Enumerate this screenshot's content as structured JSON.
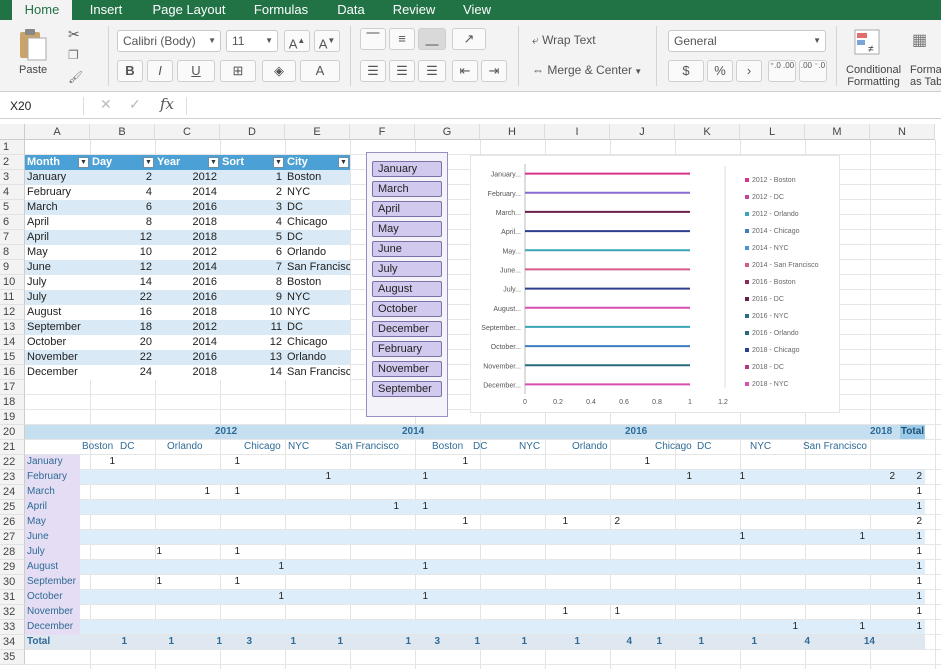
{
  "tabs": [
    "Home",
    "Insert",
    "Page Layout",
    "Formulas",
    "Data",
    "Review",
    "View"
  ],
  "ribbon": {
    "paste": "Paste",
    "font_name": "Calibri (Body)",
    "font_size": "11",
    "bold": "B",
    "italic": "I",
    "underline": "U",
    "wrap_text": "Wrap Text",
    "merge_center": "Merge & Center",
    "number_format": "General",
    "currency": "$",
    "percent": "%",
    "comma": "›",
    "dec_inc": "⁺.0 .00",
    "dec_dec": ".00 ⁻.0",
    "conditional": "Conditional",
    "formatting": "Formatting",
    "format_as": "Format",
    "as_table": "as Table"
  },
  "formula_bar": {
    "name_box": "X20",
    "fx": "fx",
    "formula": ""
  },
  "columns": [
    "A",
    "B",
    "C",
    "D",
    "E",
    "F",
    "G",
    "H",
    "I",
    "J",
    "K",
    "L",
    "M",
    "N"
  ],
  "rows": [
    "1",
    "2",
    "3",
    "4",
    "5",
    "6",
    "7",
    "8",
    "9",
    "10",
    "11",
    "12",
    "13",
    "14",
    "15",
    "16",
    "17",
    "18",
    "19",
    "20",
    "21",
    "22",
    "23",
    "24",
    "25",
    "26",
    "27",
    "28",
    "29",
    "30",
    "31",
    "32",
    "33",
    "34",
    "35"
  ],
  "table": {
    "headers": [
      "Month",
      "Day",
      "Year",
      "Sort",
      "City"
    ],
    "rows": [
      [
        "January",
        "2",
        "2012",
        "1",
        "Boston"
      ],
      [
        "February",
        "4",
        "2014",
        "2",
        "NYC"
      ],
      [
        "March",
        "6",
        "2016",
        "3",
        "DC"
      ],
      [
        "April",
        "8",
        "2018",
        "4",
        "Chicago"
      ],
      [
        "April",
        "12",
        "2018",
        "5",
        "DC"
      ],
      [
        "May",
        "10",
        "2012",
        "6",
        "Orlando"
      ],
      [
        "June",
        "12",
        "2014",
        "7",
        "San Francisco"
      ],
      [
        "July",
        "14",
        "2016",
        "8",
        "Boston"
      ],
      [
        "July",
        "22",
        "2016",
        "9",
        "NYC"
      ],
      [
        "August",
        "16",
        "2018",
        "10",
        "NYC"
      ],
      [
        "September",
        "18",
        "2012",
        "11",
        "DC"
      ],
      [
        "October",
        "20",
        "2014",
        "12",
        "Chicago"
      ],
      [
        "November",
        "22",
        "2016",
        "13",
        "Orlando"
      ],
      [
        "December",
        "24",
        "2018",
        "14",
        "San Francisco"
      ]
    ]
  },
  "slicer": {
    "items": [
      "January",
      "March",
      "April",
      "May",
      "June",
      "July",
      "August",
      "October",
      "December",
      "February",
      "November",
      "September"
    ]
  },
  "chart_data": {
    "type": "bar",
    "categories": [
      "January...",
      "February...",
      "March...",
      "April...",
      "May...",
      "June...",
      "July...",
      "August...",
      "September...",
      "October...",
      "November...",
      "December..."
    ],
    "xlim": [
      0,
      1.2
    ],
    "xticks": [
      "0",
      "0.2",
      "0.4",
      "0.6",
      "0.8",
      "1",
      "1.2"
    ],
    "series": [
      {
        "name": "2012 - Boston",
        "color": "#d6338a"
      },
      {
        "name": "2012 - DC",
        "color": "#c2479a"
      },
      {
        "name": "2012 - Orlando",
        "color": "#3aa6b5"
      },
      {
        "name": "2014 - Chicago",
        "color": "#3d7ebf"
      },
      {
        "name": "2014 - NYC",
        "color": "#4b8fd6"
      },
      {
        "name": "2014 - San Francisco",
        "color": "#d75a8c"
      },
      {
        "name": "2016 - Boston",
        "color": "#8a2b5c"
      },
      {
        "name": "2016 - DC",
        "color": "#6a1d4d"
      },
      {
        "name": "2016 - NYC",
        "color": "#2b6c8a"
      },
      {
        "name": "2016 - Orlando",
        "color": "#256b7a"
      },
      {
        "name": "2018 - Chicago",
        "color": "#2c3e8c"
      },
      {
        "name": "2018 - DC",
        "color": "#b83583"
      },
      {
        "name": "2018 - NYC",
        "color": "#d94fb1"
      }
    ],
    "bars": [
      {
        "category": "January...",
        "value": 1,
        "color": "#d6338a"
      },
      {
        "category": "February...",
        "value": 1,
        "color": "#8a6ad6"
      },
      {
        "category": "March...",
        "value": 1,
        "color": "#6a1d4d"
      },
      {
        "category": "April...",
        "value": 1,
        "color": "#2c3e8c"
      },
      {
        "category": "May...",
        "value": 1,
        "color": "#3aa6b5"
      },
      {
        "category": "June...",
        "value": 1,
        "color": "#d75a8c"
      },
      {
        "category": "July...",
        "value": 1,
        "color": "#2c3e8c"
      },
      {
        "category": "August...",
        "value": 1,
        "color": "#d94fb1"
      },
      {
        "category": "September...",
        "value": 1,
        "color": "#3aa6b5"
      },
      {
        "category": "October...",
        "value": 1,
        "color": "#3d7ebf"
      },
      {
        "category": "November...",
        "value": 1,
        "color": "#256b7a"
      },
      {
        "category": "December...",
        "value": 1,
        "color": "#d94fb1"
      }
    ]
  },
  "pivot": {
    "years": [
      "2012",
      "2014",
      "2016",
      "2018",
      "Total"
    ],
    "cities": [
      "Boston",
      "DC",
      "Orlando",
      "Chicago",
      "NYC",
      "San Francisco",
      "Boston",
      "DC",
      "NYC",
      "Orlando",
      "Chicago",
      "DC",
      "NYC",
      "San Francisco"
    ],
    "months": [
      "January",
      "February",
      "March",
      "April",
      "May",
      "June",
      "July",
      "August",
      "September",
      "October",
      "November",
      "December",
      "Total"
    ],
    "cells": [
      [
        "1",
        "",
        "",
        "1",
        "",
        "",
        "",
        "",
        "1",
        "",
        "",
        "",
        "",
        "",
        "",
        "1"
      ],
      [
        "",
        "",
        "",
        "",
        "",
        "1",
        "",
        "1",
        "",
        "",
        "",
        "1",
        "1",
        "",
        "2",
        "2"
      ],
      [
        "",
        "",
        "1",
        "1",
        "",
        "",
        "",
        "",
        "",
        "",
        "",
        "",
        "",
        "",
        "",
        "1"
      ],
      [
        "",
        "",
        "",
        "",
        "",
        "",
        "1",
        "1",
        "",
        "",
        "",
        "",
        "",
        "",
        "",
        "1"
      ],
      [
        "",
        "",
        "",
        "",
        "",
        "",
        "",
        "",
        "1",
        "",
        "1",
        "2",
        "",
        "",
        "",
        "2"
      ],
      [
        "",
        "",
        "",
        "",
        "",
        "",
        "",
        "",
        "",
        "",
        "",
        "",
        "",
        "1",
        "1",
        "1"
      ],
      [
        "",
        "1",
        "",
        "1",
        "",
        "",
        "",
        "",
        "",
        "",
        "",
        "",
        "",
        "",
        "",
        "1"
      ],
      [
        "",
        "",
        "",
        "",
        "1",
        "",
        "",
        "1",
        "",
        "",
        "",
        "",
        "",
        "",
        "",
        "1"
      ],
      [
        "",
        "1",
        "",
        "1",
        "",
        "",
        "",
        "",
        "",
        "",
        "",
        "",
        "",
        "",
        "",
        "1"
      ],
      [
        "",
        "",
        "",
        "",
        "1",
        "",
        "",
        "1",
        "",
        "",
        "",
        "",
        "",
        "",
        "",
        "1"
      ],
      [
        "",
        "",
        "",
        "",
        "",
        "",
        "",
        "",
        "",
        "",
        "1",
        "1",
        "",
        "",
        "",
        "1"
      ],
      [
        "",
        "",
        "",
        "",
        "",
        "",
        "",
        "",
        "",
        "",
        "",
        "",
        "",
        "1",
        "1",
        "1"
      ],
      [
        "1",
        "1",
        "1",
        "3",
        "1",
        "1",
        "1",
        "3",
        "1",
        "1",
        "1",
        "4",
        "1",
        "1",
        "1",
        "4",
        "14"
      ]
    ]
  }
}
